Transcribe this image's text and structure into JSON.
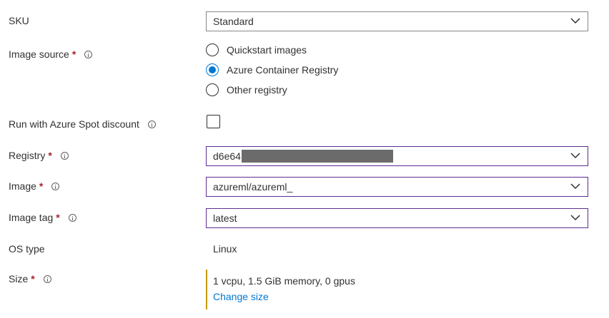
{
  "fields": {
    "sku": {
      "label": "SKU",
      "value": "Standard"
    },
    "image_source": {
      "label": "Image source",
      "required_mark": "*",
      "options": [
        "Quickstart images",
        "Azure Container Registry",
        "Other registry"
      ],
      "selected": "Azure Container Registry"
    },
    "spot": {
      "label": "Run with Azure Spot discount",
      "checked": false
    },
    "registry": {
      "label": "Registry",
      "required_mark": "*",
      "value": "d6e64"
    },
    "image": {
      "label": "Image",
      "required_mark": "*",
      "value": "azureml/azureml_"
    },
    "image_tag": {
      "label": "Image tag",
      "required_mark": "*",
      "value": "latest"
    },
    "os_type": {
      "label": "OS type",
      "value": "Linux"
    },
    "size": {
      "label": "Size",
      "required_mark": "*",
      "value": "1 vcpu, 1.5 GiB memory, 0 gpus",
      "change_link": "Change size"
    }
  },
  "colors": {
    "accent": "#0078d4",
    "focus_border": "#5c2d91",
    "required": "#a4262c",
    "size_bar": "#c19c00"
  },
  "icons": {
    "info": "info-icon",
    "dropdown": "chevron-down-icon"
  }
}
